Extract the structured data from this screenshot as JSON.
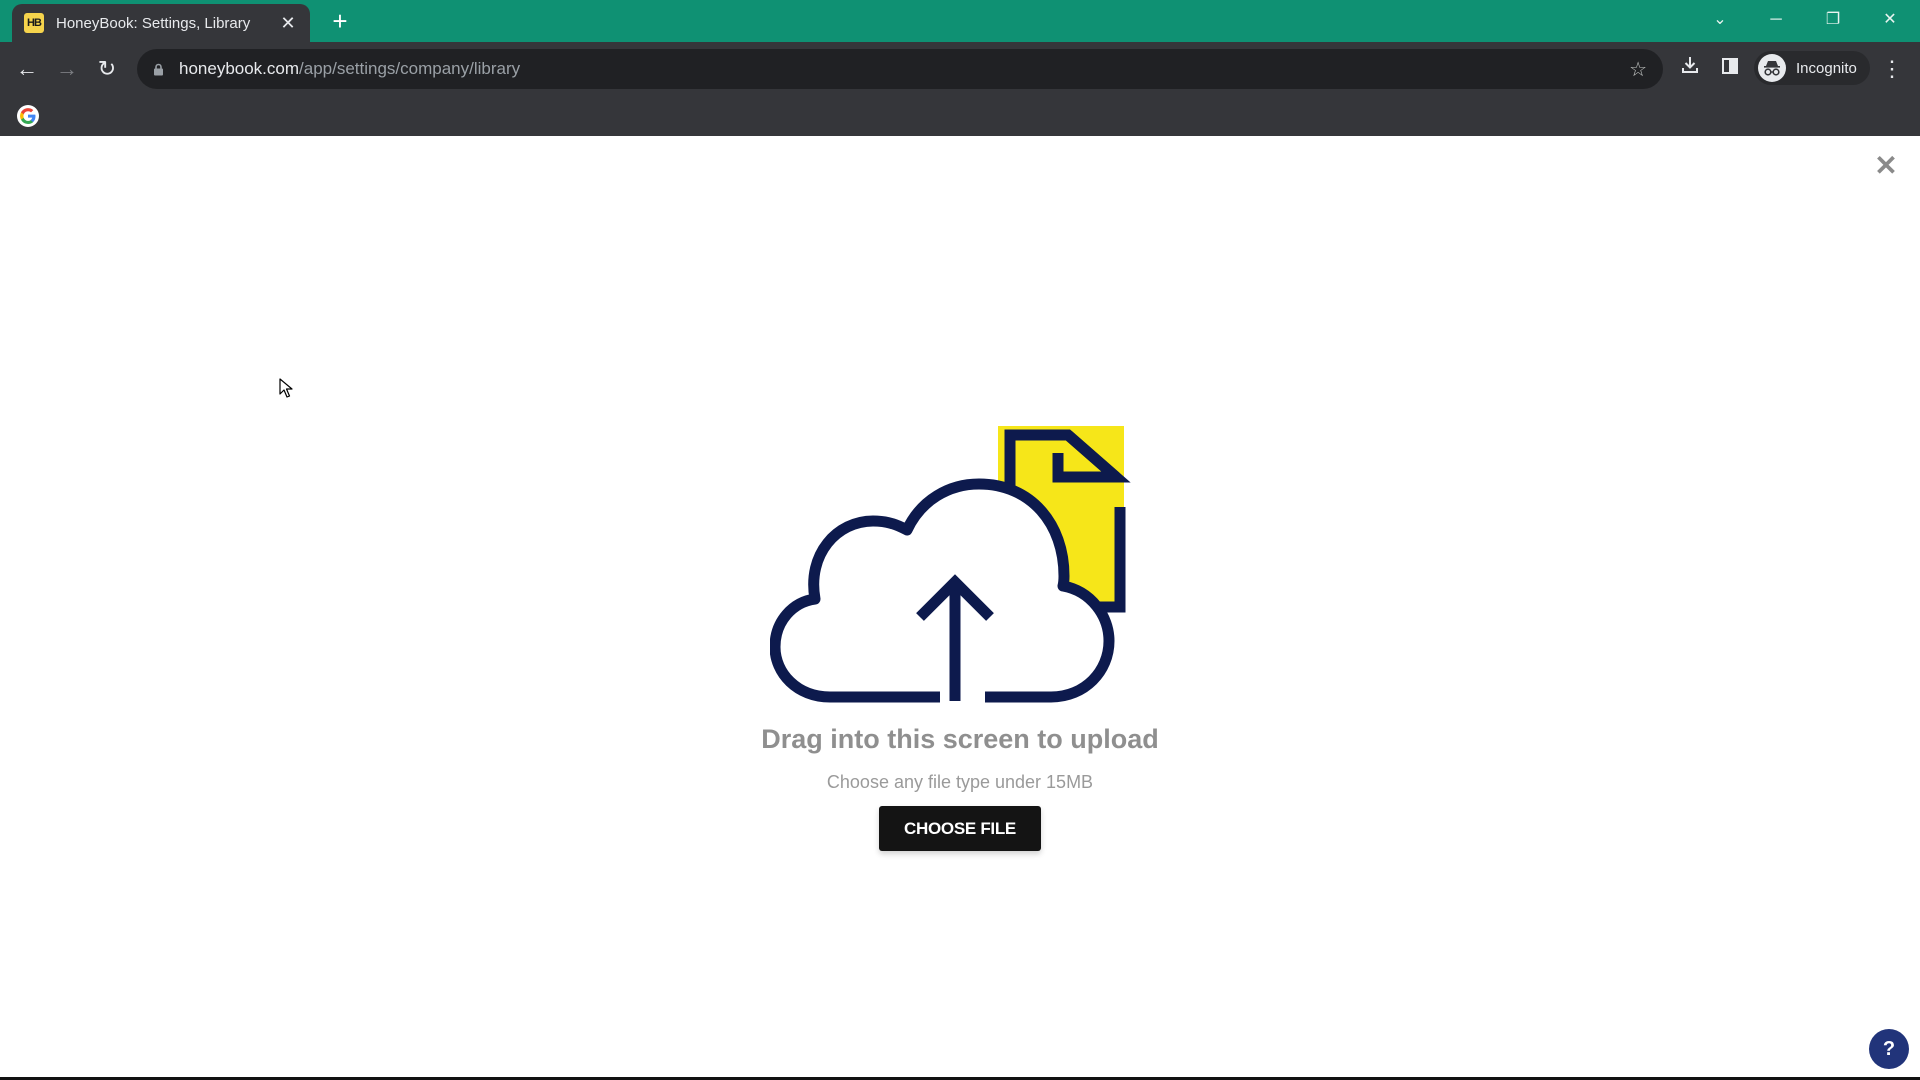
{
  "browser": {
    "tab": {
      "favicon_text": "HB",
      "title": "HoneyBook: Settings, Library",
      "close_glyph": "✕"
    },
    "new_tab_glyph": "+",
    "window_controls": {
      "tab_search_glyph": "⌄",
      "minimize_glyph": "─",
      "restore_glyph": "❐",
      "close_glyph": "✕"
    },
    "nav": {
      "back_glyph": "←",
      "forward_glyph": "→",
      "reload_glyph": "↻"
    },
    "address": {
      "lock_glyph": "🔒",
      "host": "honeybook.com",
      "path": "/app/settings/company/library"
    },
    "bookmark_glyph": "☆",
    "download_glyph": "⤓",
    "side_panel_glyph": "▮",
    "profile": {
      "label": "Incognito",
      "avatar_glyph": "🕶"
    },
    "menu_glyph": "⋮",
    "bookmarks_bar": {
      "google_glyph": "G"
    }
  },
  "upload": {
    "close_glyph": "✕",
    "headline": "Drag into this screen to upload",
    "subline": "Choose any file type under 15MB",
    "button_label": "CHOOSE FILE",
    "help_glyph": "?",
    "colors": {
      "illustration_stroke": "#0d1a4d",
      "illustration_accent": "#f6e619",
      "button_bg": "#141414",
      "help_bg": "#21347a"
    }
  }
}
